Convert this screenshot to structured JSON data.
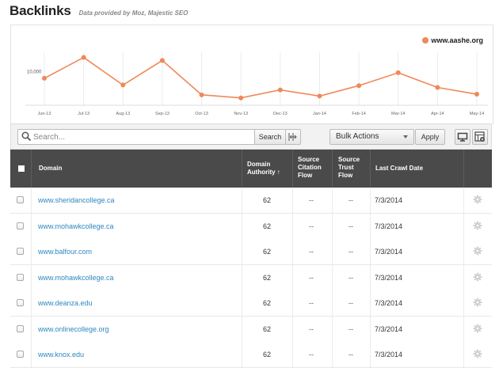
{
  "header": {
    "title": "Backlinks",
    "subtitle": "Data provided by Moz, Majestic SEO"
  },
  "chart_data": {
    "type": "line",
    "categories": [
      "Jun-13",
      "Jul-13",
      "Aug-13",
      "Sep-13",
      "Oct-13",
      "Nov-13",
      "Dec-13",
      "Jan-14",
      "Feb-14",
      "Mar-14",
      "Apr-14",
      "May-14"
    ],
    "series": [
      {
        "name": "www.aashe.org",
        "values": [
          9400,
          12800,
          8300,
          12300,
          6700,
          6200,
          7500,
          6500,
          8200,
          10300,
          7900,
          6800
        ]
      }
    ],
    "y_tick_labels": [
      "10,000"
    ],
    "y_tick_values": [
      10000
    ],
    "ylim": [
      5000,
      17000
    ],
    "grid": "vertical",
    "legend": "top-right",
    "color": "#f0885a"
  },
  "toolbar": {
    "search_placeholder": "Search...",
    "search_button": "Search",
    "bulk_actions": "Bulk Actions",
    "apply": "Apply"
  },
  "table": {
    "headers": {
      "domain": "Domain",
      "authority_line1": "Domain",
      "authority_line2": "Authority ↑",
      "citation_line1": "Source",
      "citation_line2": "Citation",
      "citation_line3": "Flow",
      "trust_line1": "Source",
      "trust_line2": "Trust",
      "trust_line3": "Flow",
      "crawl": "Last Crawl Date"
    },
    "rows": [
      {
        "domain": "www.sheridancollege.ca",
        "authority": "62",
        "citation": "--",
        "trust": "--",
        "date": "7/3/2014"
      },
      {
        "domain": "www.mohawkcollege.ca",
        "authority": "62",
        "citation": "--",
        "trust": "--",
        "date": "7/3/2014"
      },
      {
        "domain": "www.balfour.com",
        "authority": "62",
        "citation": "--",
        "trust": "--",
        "date": "7/3/2014"
      },
      {
        "domain": "www.mohawkcollege.ca",
        "authority": "62",
        "citation": "--",
        "trust": "--",
        "date": "7/3/2014"
      },
      {
        "domain": "www.deanza.edu",
        "authority": "62",
        "citation": "--",
        "trust": "--",
        "date": "7/3/2014"
      },
      {
        "domain": "www.onlinecollege.org",
        "authority": "62",
        "citation": "--",
        "trust": "--",
        "date": "7/3/2014"
      },
      {
        "domain": "www.knox.edu",
        "authority": "62",
        "citation": "--",
        "trust": "--",
        "date": "7/3/2014"
      }
    ]
  },
  "icons": {
    "search": "search-icon",
    "columns": "column-adjust-icon",
    "display": "monitor-icon",
    "settings": "table-settings-icon",
    "row_action": "gear-icon"
  }
}
